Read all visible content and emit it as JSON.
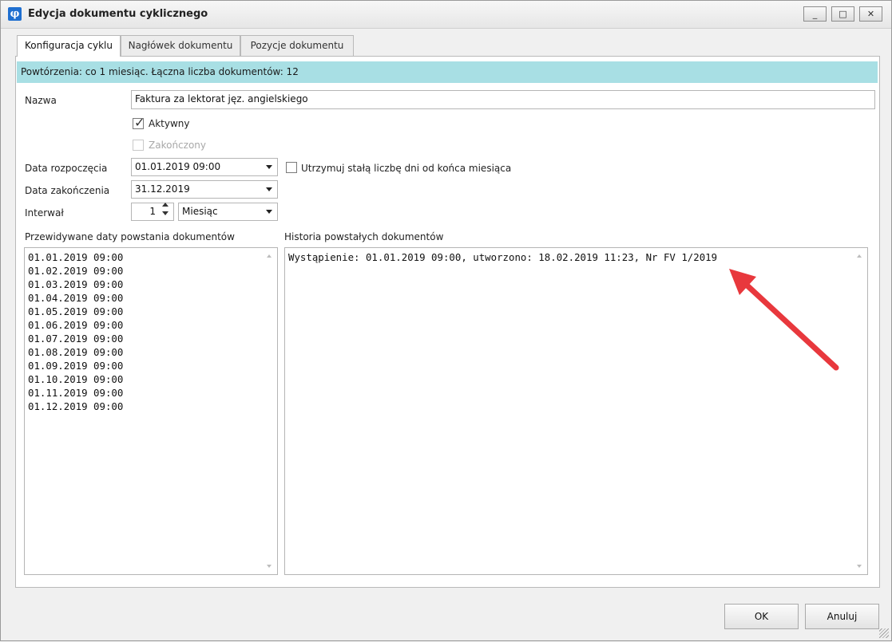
{
  "window": {
    "title": "Edycja dokumentu cyklicznego",
    "app_icon_glyph": "φ"
  },
  "window_controls": [
    "_",
    "□",
    "✕"
  ],
  "tabs": [
    {
      "label": "Konfiguracja cyklu",
      "active": true
    },
    {
      "label": "Nagłówek dokumentu",
      "active": false
    },
    {
      "label": "Pozycje dokumentu",
      "active": false
    }
  ],
  "info_bar": {
    "text": "Powtórzenia: co 1 miesiąc. Łączna liczba dokumentów: 12",
    "color": "#a8dfe4"
  },
  "form": {
    "name_label": "Nazwa",
    "name_value": "Faktura za lektorat jęz. angielskiego",
    "active_label": "Aktywny",
    "active_checked": true,
    "finished_label": "Zakończony",
    "finished_checked": false,
    "start_label": "Data rozpoczęcia",
    "start_value": "01.01.2019 09:00",
    "keep_days_label": "Utrzymuj stałą liczbę dni od końca miesiąca",
    "keep_days_checked": false,
    "end_label": "Data zakończenia",
    "end_value": "31.12.2019",
    "interval_label": "Interwał",
    "interval_value": "1",
    "interval_unit": "Miesiąc"
  },
  "forecast": {
    "label": "Przewidywane daty powstania dokumentów",
    "items": [
      "01.01.2019 09:00",
      "01.02.2019 09:00",
      "01.03.2019 09:00",
      "01.04.2019 09:00",
      "01.05.2019 09:00",
      "01.06.2019 09:00",
      "01.07.2019 09:00",
      "01.08.2019 09:00",
      "01.09.2019 09:00",
      "01.10.2019 09:00",
      "01.11.2019 09:00",
      "01.12.2019 09:00"
    ]
  },
  "history": {
    "label": "Historia powstałych dokumentów",
    "items": [
      "Wystąpienie: 01.01.2019 09:00, utworzono: 18.02.2019 11:23, Nr FV 1/2019"
    ]
  },
  "buttons": {
    "ok": "OK",
    "cancel": "Anuluj"
  },
  "annotation": {
    "color": "#e8383d"
  }
}
